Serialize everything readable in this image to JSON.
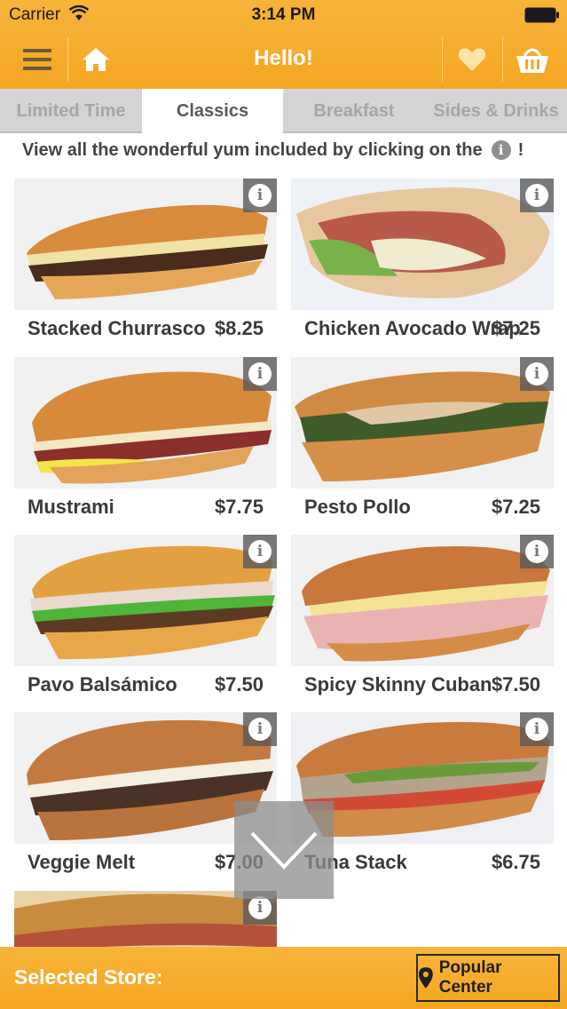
{
  "status_bar": {
    "carrier": "Carrier",
    "time": "3:14 PM"
  },
  "navbar": {
    "title": "Hello!"
  },
  "tabs": [
    {
      "label": "Limited Time",
      "active": false
    },
    {
      "label": "Classics",
      "active": true
    },
    {
      "label": "Breakfast",
      "active": false
    },
    {
      "label": "Sides & Drinks",
      "active": false
    }
  ],
  "info": {
    "text_before": "View all the wonderful yum included by clicking on the",
    "text_after": "!"
  },
  "items": [
    {
      "name": "Stacked Churrasco",
      "price": "$8.25"
    },
    {
      "name": "Chicken Avocado Wrap",
      "price": "$7.25"
    },
    {
      "name": "Mustrami",
      "price": "$7.75"
    },
    {
      "name": "Pesto Pollo",
      "price": "$7.25"
    },
    {
      "name": "Pavo Balsámico",
      "price": "$7.50"
    },
    {
      "name": "Spicy Skinny Cuban",
      "price": "$7.50"
    },
    {
      "name": "Veggie Melt",
      "price": "$7.00"
    },
    {
      "name": "Tuna Stack",
      "price": "$6.75"
    }
  ],
  "footer": {
    "label": "Selected Store:",
    "store_name": "Popular Center"
  },
  "colors": {
    "brand": "#f5a623",
    "tab_bg": "#d4d4d4",
    "text": "#3a3a3a"
  }
}
